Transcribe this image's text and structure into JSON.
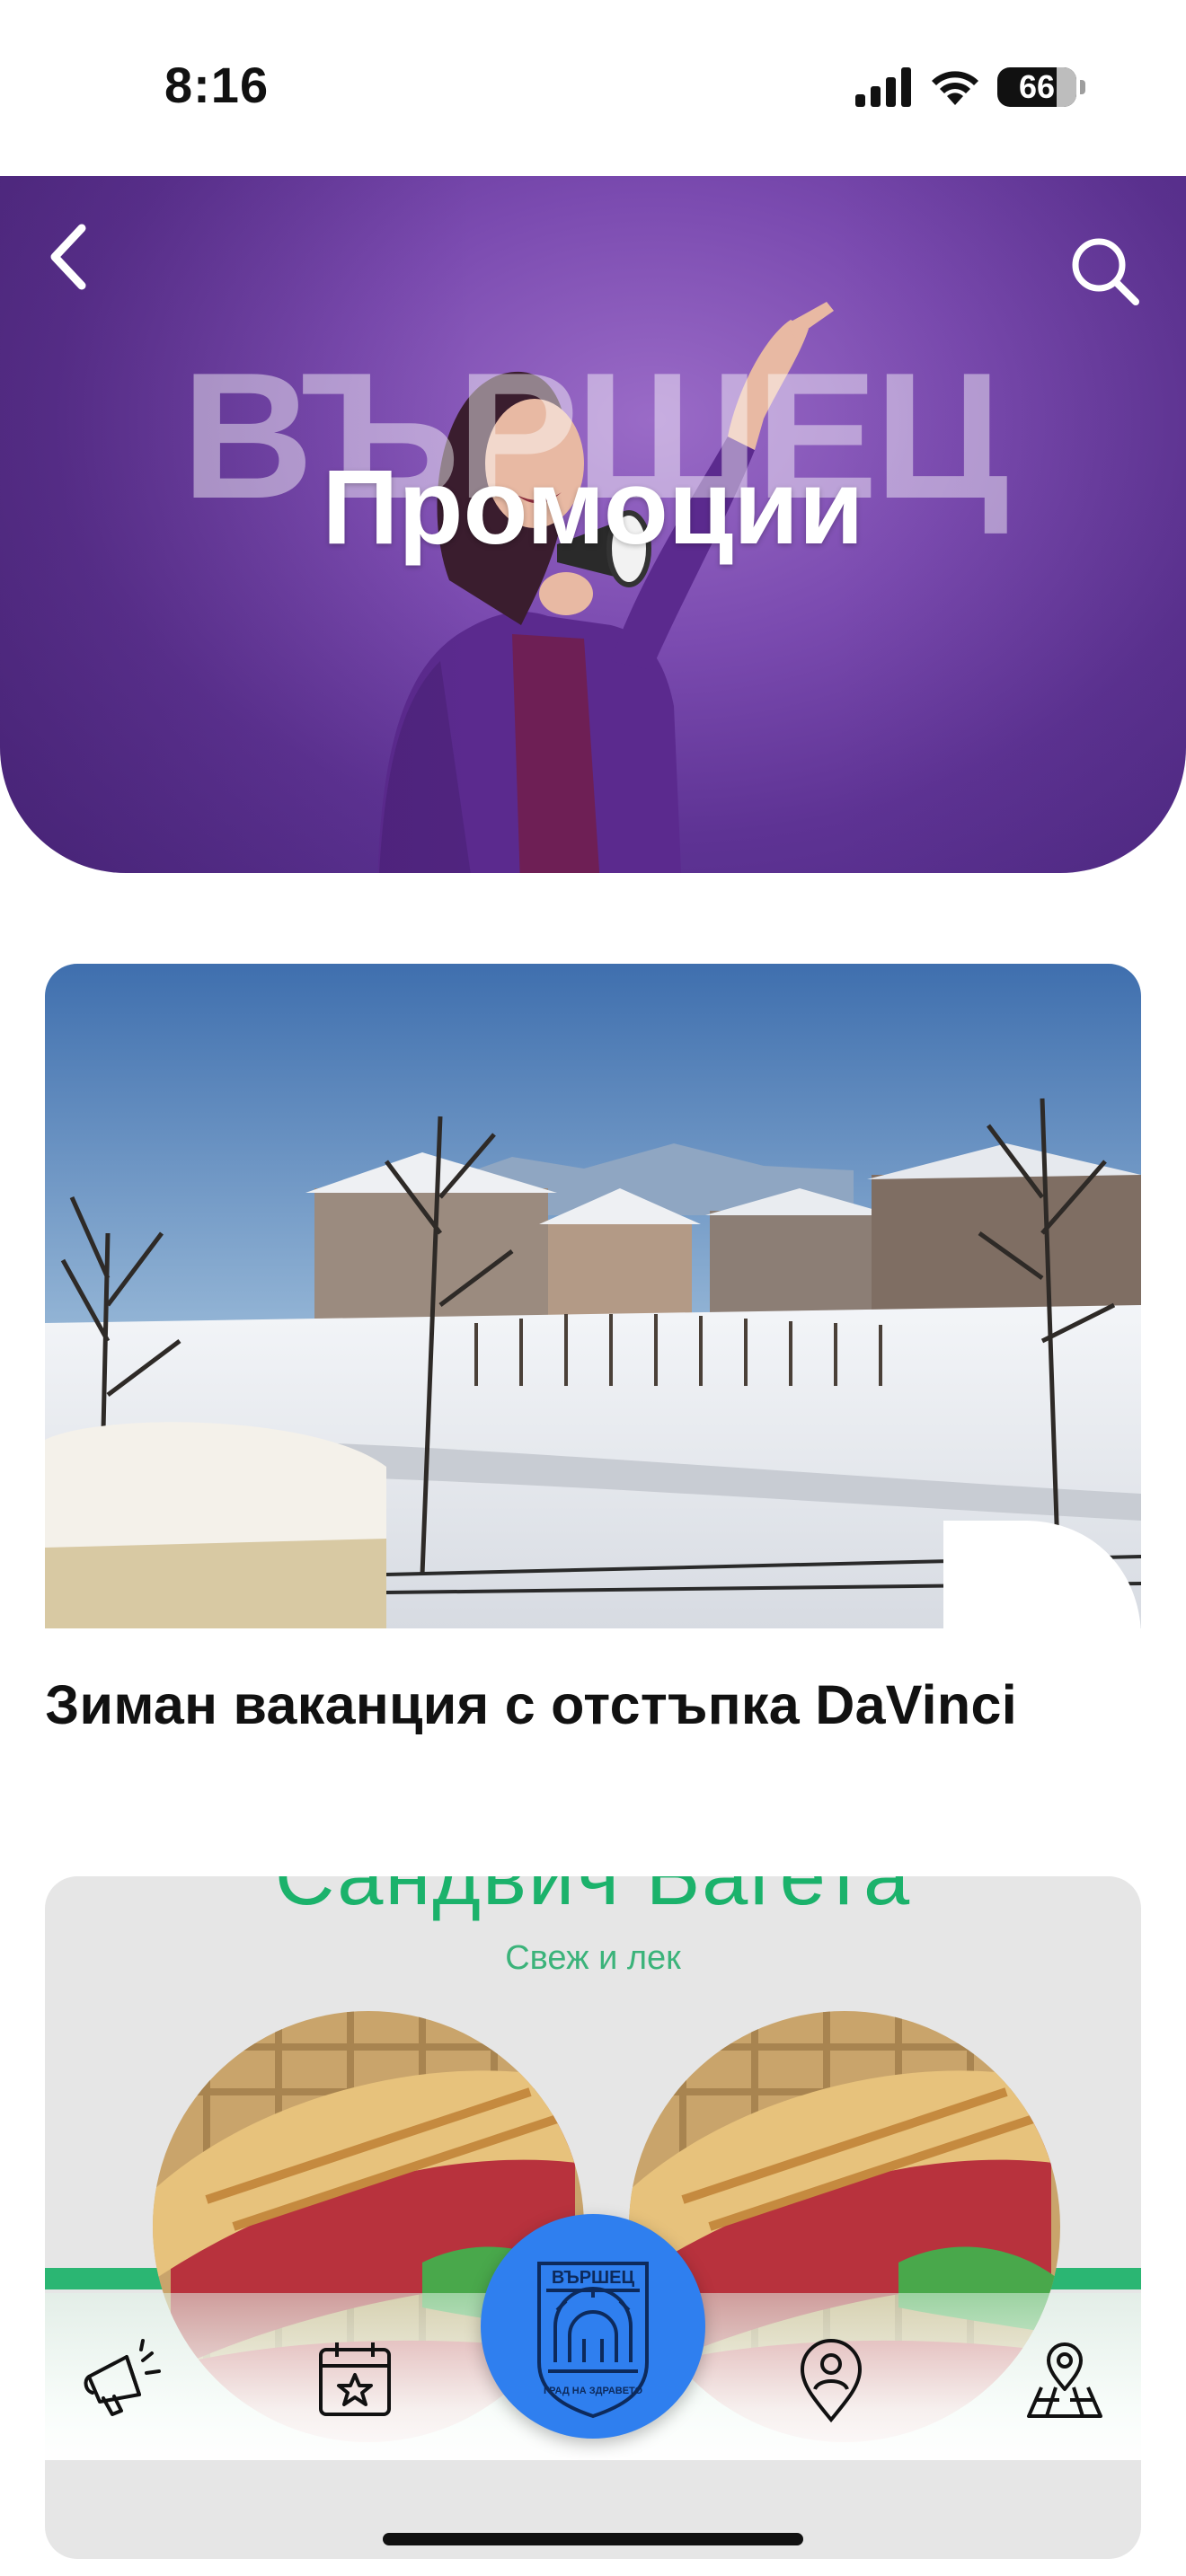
{
  "status_bar": {
    "time": "8:16",
    "battery": "66"
  },
  "hero": {
    "watermark": "ВЪРШЕЦ",
    "title": "Промоции",
    "back_icon": "chevron-left-icon",
    "search_icon": "search-icon"
  },
  "promotions": [
    {
      "title": "Зиман ваканция с отстъпка DaVinci",
      "image": "snowy-village-photo"
    },
    {
      "title": "",
      "image_heading": "Сандвич Багета",
      "image_subtitle": "Свеж и лек",
      "image": "sandwich-promo-photo"
    }
  ],
  "bottom_nav": {
    "items": [
      {
        "name": "promotions",
        "icon": "megaphone-icon"
      },
      {
        "name": "events",
        "icon": "calendar-star-icon"
      },
      {
        "name": "home",
        "icon": "varshets-emblem-icon",
        "emblem_text_top": "ВЪРШЕЦ",
        "emblem_text_bottom": "ГРАД НА ЗДРАВЕТО"
      },
      {
        "name": "profile",
        "icon": "user-pin-icon"
      },
      {
        "name": "map",
        "icon": "map-pin-icon"
      }
    ]
  },
  "colors": {
    "hero_purple": "#6a3ca3",
    "nav_blue": "#2f7fef",
    "promo_green": "#1bb26b"
  }
}
